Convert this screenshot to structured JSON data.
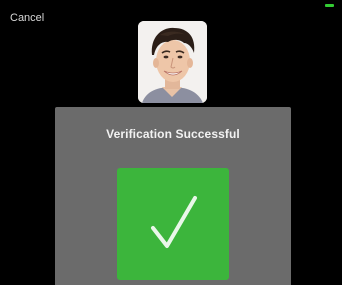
{
  "header": {
    "cancel_label": "Cancel"
  },
  "status_bar": {
    "battery_color": "#33cc33"
  },
  "profile": {
    "photo_icon": "face-photo"
  },
  "result": {
    "title": "Verification Successful",
    "icon": "checkmark-icon",
    "accent_color": "#3cb53c",
    "panel_color": "#6b6b6b"
  }
}
